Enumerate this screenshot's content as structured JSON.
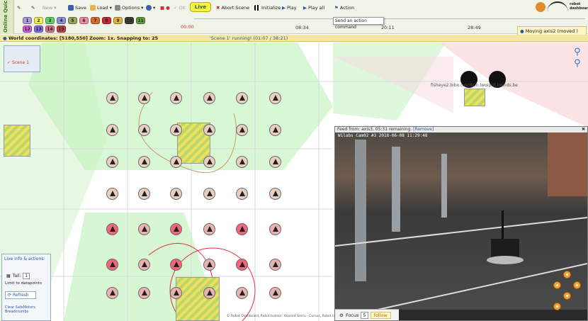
{
  "toolbar": {
    "new_label": "New",
    "save_label": "Save",
    "load_label": "Load",
    "options_label": "Options",
    "live_label": "Live",
    "abort_label": "Abort Scene",
    "initialize_label": "Initialize",
    "play_label": "Play",
    "play_all_label": "Play all",
    "action_label": "Action",
    "online_label": "Online Quick"
  },
  "robot_swatches": [
    {
      "n": "1",
      "color": "#b09adc"
    },
    {
      "n": "2",
      "color": "#f2f04e"
    },
    {
      "n": "3",
      "color": "#5ed16a"
    },
    {
      "n": "4",
      "color": "#8d8fd9"
    },
    {
      "n": "5",
      "color": "#9aa45d"
    },
    {
      "n": "6",
      "color": "#f48aa6"
    },
    {
      "n": "7",
      "color": "#d96c30"
    },
    {
      "n": "8",
      "color": "#c7283a"
    },
    {
      "n": "9",
      "color": "#e3b43a"
    },
    {
      "n": "10",
      "color": "#3e3e36"
    },
    {
      "n": "11",
      "color": "#64a13f"
    },
    {
      "n": "12",
      "color": "#d060d6"
    },
    {
      "n": "13",
      "color": "#8a6be1"
    },
    {
      "n": "14",
      "color": "#d8718f"
    },
    {
      "n": "15",
      "color": "#c04242"
    }
  ],
  "timeline": {
    "start": "00:00",
    "ticks": [
      "08:34",
      "20:11",
      "28:49"
    ]
  },
  "tooltip": "Send an action command",
  "toast": "Moving axis2 (moved )",
  "world": "World coordinates: [5180,550] Zoom: 1x. Snapping to: 25",
  "scene_status": "'Scene 1' running! (01:07 / 38:21)",
  "scene_tab": "Scene 1",
  "branding": {
    "logo_text": "robot dashboard"
  },
  "left_panel": {
    "title": "Live info & actions:",
    "tail_label": "Tail:",
    "tail_value": "1",
    "limit_label": "Limit to datapoints",
    "refresh_label": "Refresh",
    "clear_label": "Clear SafeMotors Breadcrumbs"
  },
  "feed": {
    "header": "Feed from: axis3, 05:31 remaining.",
    "remove": "[Remove]",
    "caption": "Wilabs Cam02 #3 2018-06-08 11:29:48",
    "focus_label": "Focus",
    "focus_value": "5",
    "follow_label": "follow"
  },
  "map_text": {
    "fisheye": "fisheye2.bibo.ruscitcin.lwoiprit.iminds.be",
    "footer": "© Robot Dashboard, Robot builder: Vincent Sercu - Cursus, Robot Interface"
  }
}
